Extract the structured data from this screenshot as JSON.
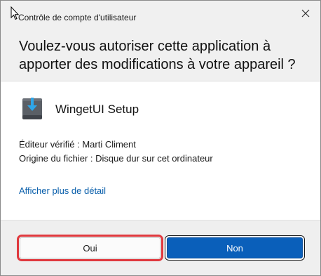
{
  "window": {
    "title": "Contrôle de compte d'utilisateur",
    "close_icon": "close-icon"
  },
  "prompt": {
    "question": "Voulez-vous autoriser cette application à apporter des modifications à votre appareil ?"
  },
  "app": {
    "icon": "installer-icon",
    "name": "WingetUI Setup",
    "publisher": "Éditeur vérifié : Marti Climent",
    "origin": "Origine du fichier : Disque dur sur cet ordinateur"
  },
  "details_link": "Afficher plus de détail",
  "buttons": {
    "yes_label": "Oui",
    "no_label": "Non"
  },
  "colors": {
    "header_bg": "#f0f0f0",
    "footer_bg": "#efefef",
    "accent": "#0a5fba",
    "link": "#0a5fab",
    "highlight": "#e0393e"
  }
}
